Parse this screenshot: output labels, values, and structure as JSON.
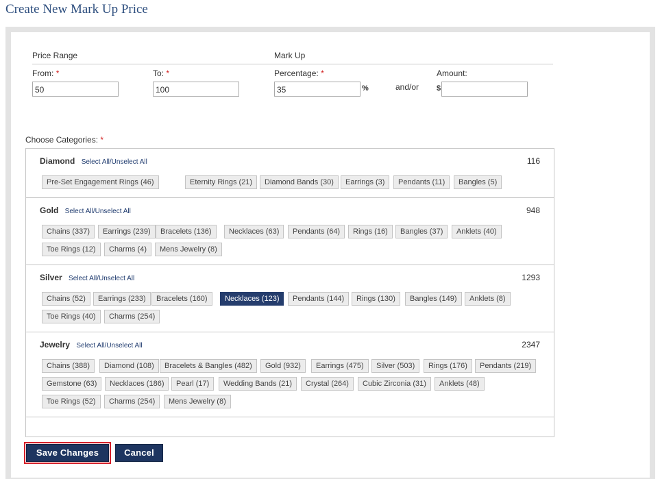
{
  "page": {
    "title": "Create New Mark Up Price"
  },
  "price_range": {
    "section_label": "Price Range",
    "from_label": "From:",
    "from_value": "50",
    "to_label": "To:",
    "to_value": "100"
  },
  "mark_up": {
    "section_label": "Mark Up",
    "percentage_label": "Percentage:",
    "percentage_value": "35",
    "percent_suffix": "%",
    "and_or": "and/or",
    "amount_label": "Amount:",
    "currency_prefix": "$",
    "amount_value": ""
  },
  "required_marker": "*",
  "categories": {
    "label": "Choose Categories:",
    "select_all": "Select All",
    "separator": "/",
    "unselect_all": "Unselect All",
    "groups": [
      {
        "name": "Diamond",
        "count": "116",
        "items": [
          "Pre-Set Engagement Rings (46)",
          "Eternity Rings (21)",
          "Diamond Bands (30)",
          "Earrings (3)",
          "Pendants (11)",
          "Bangles (5)"
        ]
      },
      {
        "name": "Gold",
        "count": "948",
        "items": [
          "Chains (337)",
          "Earrings (239)",
          "Bracelets (136)",
          "Necklaces (63)",
          "Pendants (64)",
          "Rings (16)",
          "Bangles (37)",
          "Anklets (40)",
          "Toe Rings (12)",
          "Charms (4)",
          "Mens Jewelry (8)"
        ]
      },
      {
        "name": "Silver",
        "count": "1293",
        "items": [
          "Chains (52)",
          "Earrings (233)",
          "Bracelets (160)",
          "Necklaces (123)",
          "Pendants (144)",
          "Rings (130)",
          "Bangles (149)",
          "Anklets (8)",
          "Toe Rings (40)",
          "Charms (254)"
        ],
        "selected": [
          "Necklaces (123)"
        ]
      },
      {
        "name": "Jewelry",
        "count": "2347",
        "items": [
          "Chains (388)",
          "Diamond (108)",
          "Bracelets & Bangles (482)",
          "Gold (932)",
          "Earrings (475)",
          "Silver (503)",
          "Rings (176)",
          "Pendants (219)",
          "Gemstone (63)",
          "Necklaces (186)",
          "Pearl (17)",
          "Wedding Bands (21)",
          "Crystal (264)",
          "Cubic Zirconia (31)",
          "Anklets (48)",
          "Toe Rings (52)",
          "Charms (254)",
          "Mens Jewelry (8)"
        ]
      }
    ]
  },
  "actions": {
    "save_label": "Save Changes",
    "cancel_label": "Cancel"
  },
  "colors": {
    "title": "#2d4e7e",
    "primary_button": "#1e3560",
    "selected_chip": "#253d6d",
    "required": "#d21f1f",
    "focus_outline": "#d4202a"
  }
}
